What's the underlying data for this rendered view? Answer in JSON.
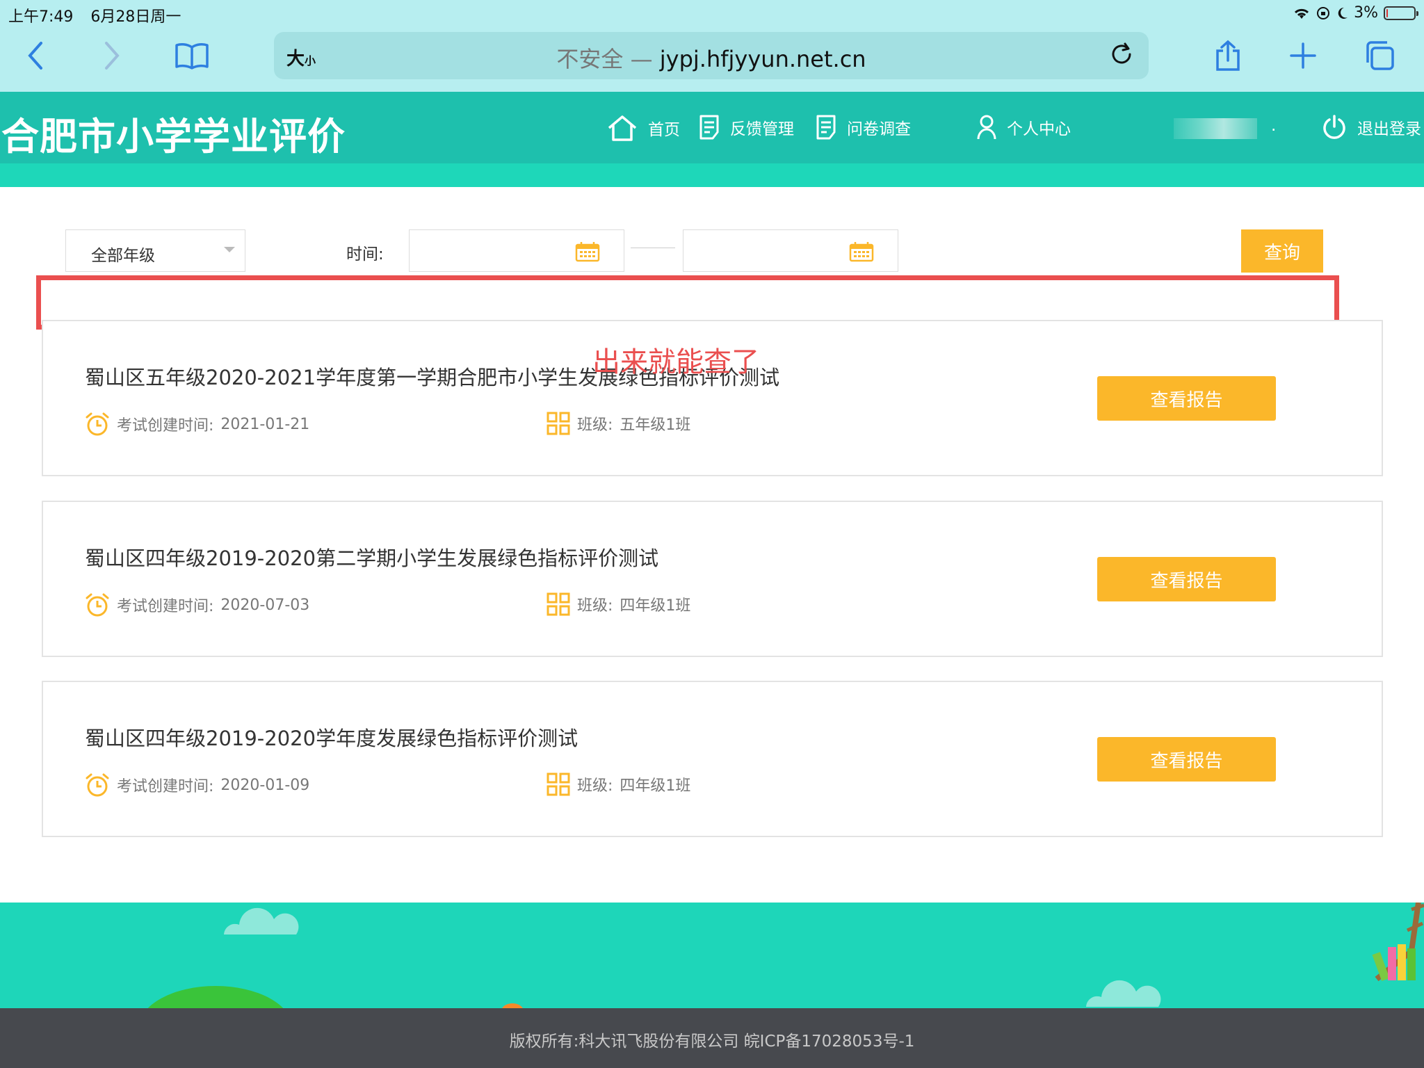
{
  "status": {
    "time": "上午7:49",
    "date": "6月28日周一",
    "battery": "3%",
    "battery_level": 0.03
  },
  "browser": {
    "aa_label": "大",
    "aa_small": "小",
    "insecure_label": "不安全 — ",
    "url": "jypj.hfjyyun.net.cn"
  },
  "header": {
    "site_title": "合肥市小学学业评价",
    "nav": {
      "home": "首页",
      "feedback": "反馈管理",
      "survey": "问卷调查",
      "profile": "个人中心",
      "user_dot": ".",
      "logout": "退出登录"
    },
    "accent": "#1ec0ad"
  },
  "filter": {
    "grade_select": "全部年级",
    "time_label": "时间:",
    "query_button": "查询"
  },
  "annotation": {
    "text": "出来就能查了",
    "color": "#ea4f4f"
  },
  "reports": [
    {
      "title": "蜀山区五年级2020-2021学年度第一学期合肥市小学生发展绿色指标评价测试",
      "created_label": "考试创建时间:",
      "created_date": "2021-01-21",
      "class_label": "班级:",
      "class_value": "五年级1班",
      "button": "查看报告"
    },
    {
      "title": "蜀山区四年级2019-2020第二学期小学生发展绿色指标评价测试",
      "created_label": "考试创建时间:",
      "created_date": "2020-07-03",
      "class_label": "班级:",
      "class_value": "四年级1班",
      "button": "查看报告"
    },
    {
      "title": "蜀山区四年级2019-2020学年度发展绿色指标评价测试",
      "created_label": "考试创建时间:",
      "created_date": "2020-01-09",
      "class_label": "班级:",
      "class_value": "四年级1班",
      "button": "查看报告"
    }
  ],
  "footer": {
    "copyright": "版权所有:科大讯飞股份有限公司 皖ICP备17028053号-1"
  },
  "colors": {
    "button": "#fbb72a",
    "footer_bg": "#47494e",
    "browser_bar": "#b7eef0"
  }
}
